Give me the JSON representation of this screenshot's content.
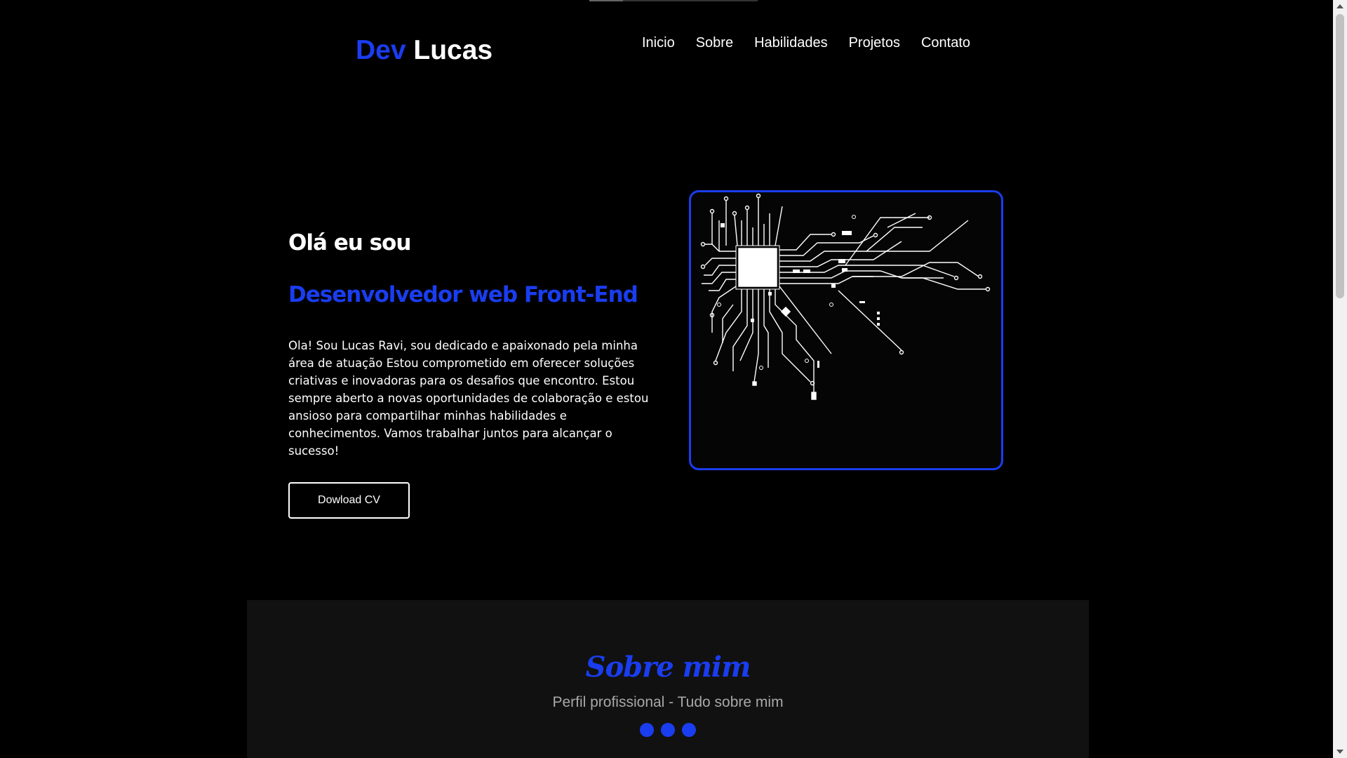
{
  "header": {
    "logo_accent": "Dev",
    "logo_main": "Lucas",
    "nav": [
      {
        "label": "Inicio"
      },
      {
        "label": "Sobre"
      },
      {
        "label": "Habilidades"
      },
      {
        "label": "Projetos"
      },
      {
        "label": "Contato"
      }
    ]
  },
  "hero": {
    "greeting": "Olá eu sou",
    "role": "Desenvolvedor web Front-End",
    "description": "Ola! Sou Lucas Ravi, sou dedicado e apaixonado pela minha área de atuação Estou comprometido em oferecer soluções criativas e inovadoras para os desafios que encontro. Estou sempre aberto a novas oportunidades de colaboração e estou ansioso para compartilhar minhas habilidades e conhecimentos. Vamos trabalhar juntos para alcançar o sucesso!",
    "cv_button": "Dowload CV",
    "image_icon": "circuit-board-icon"
  },
  "about": {
    "title": "Sobre mim",
    "subtitle": "Perfil profissional - Tudo sobre mim",
    "dots": 3
  },
  "colors": {
    "accent": "#1a3df0",
    "background": "#000000",
    "section_bg": "#111111"
  }
}
